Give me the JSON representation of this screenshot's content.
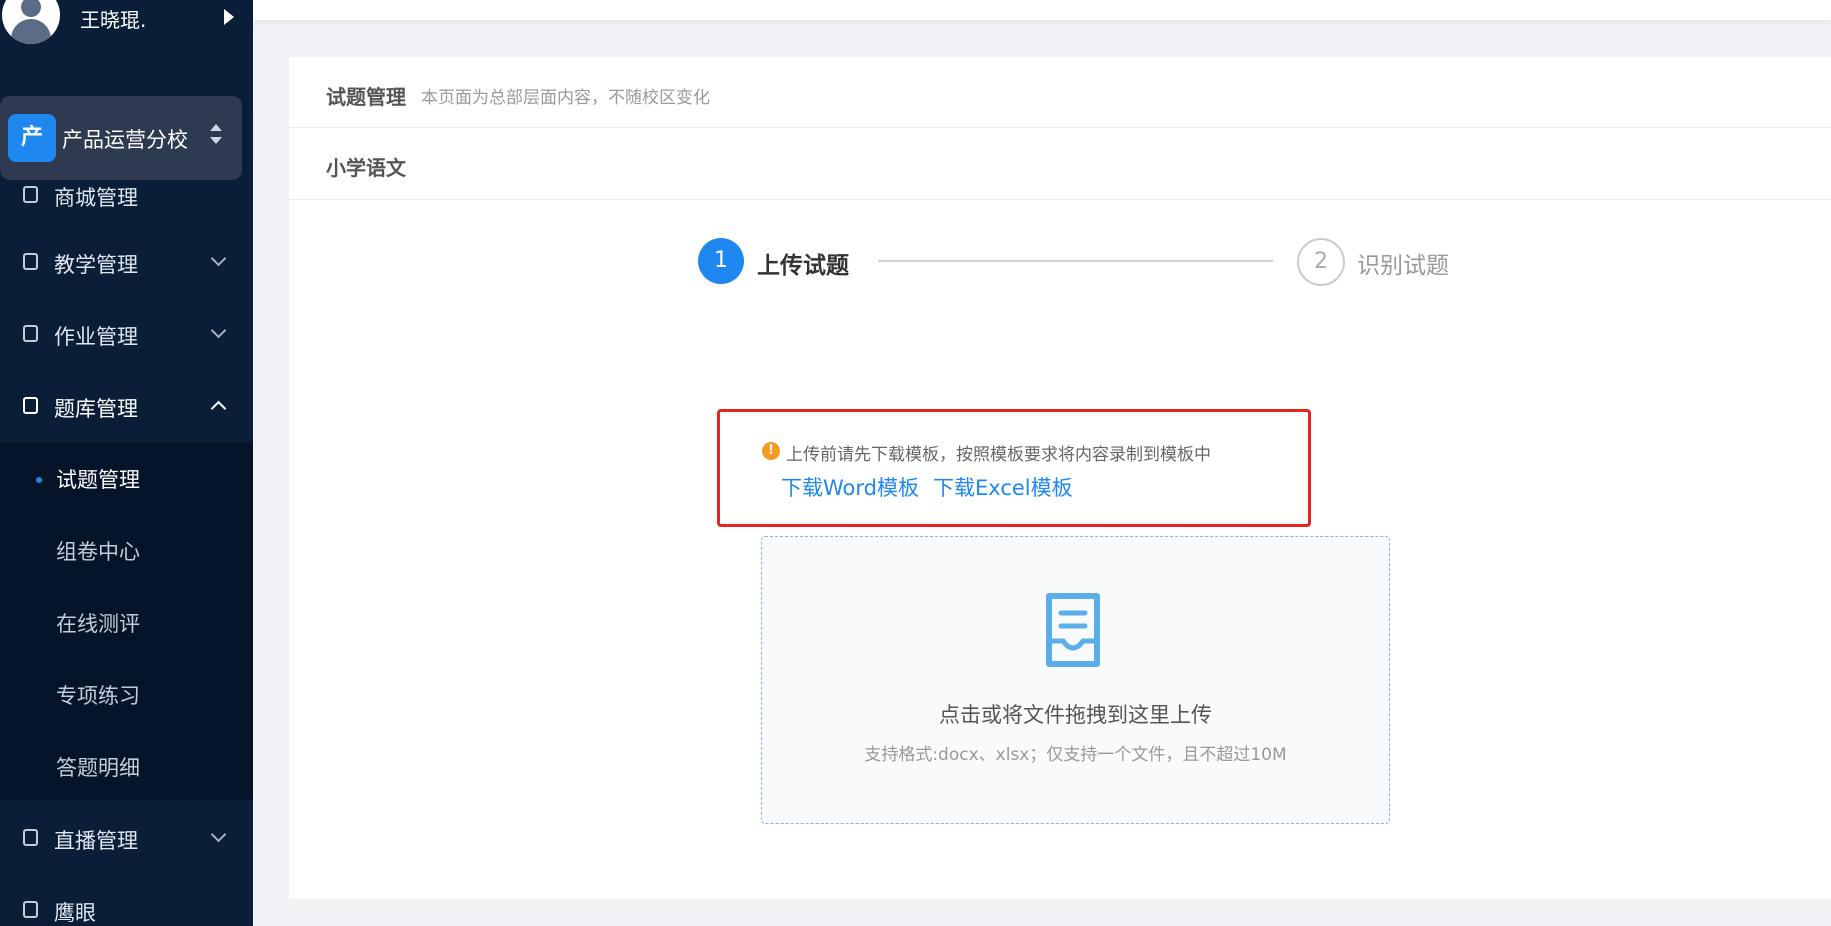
{
  "sidebar": {
    "user": {
      "name": "王晓琨."
    },
    "campus": {
      "badge": "产",
      "name": "产品运营分校"
    },
    "partial_item": {
      "label": "商城管理"
    },
    "menu": [
      {
        "label": "教学管理",
        "icon": "teaching-icon"
      },
      {
        "label": "作业管理",
        "icon": "homework-icon"
      },
      {
        "label": "题库管理",
        "icon": "question-bank-icon"
      },
      {
        "label": "直播管理",
        "icon": "live-icon"
      },
      {
        "label": "鹰眼",
        "icon": "eagle-eye-icon"
      }
    ],
    "submenu": [
      {
        "label": "试题管理"
      },
      {
        "label": "组卷中心"
      },
      {
        "label": "在线测评"
      },
      {
        "label": "专项练习"
      },
      {
        "label": "答题明细"
      }
    ]
  },
  "page": {
    "title": "试题管理",
    "description": "本页面为总部层面内容，不随校区变化",
    "subject": "小学语文"
  },
  "steps": [
    {
      "number": "1",
      "label": "上传试题",
      "state": "active"
    },
    {
      "number": "2",
      "label": "识别试题",
      "state": "pending"
    }
  ],
  "notice": {
    "text": "上传前请先下载模板，按照模板要求将内容录制到模板中",
    "link_word": "下载Word模板",
    "link_excel": "下载Excel模板"
  },
  "upload": {
    "main_text": "点击或将文件拖拽到这里上传",
    "hint": "支持格式:docx、xlsx；仅支持一个文件，且不超过10M"
  },
  "colors": {
    "sidebar_bg": "#0b1e38",
    "accent": "#1e88f0",
    "highlight_border": "#e5231f",
    "warning": "#f59a23"
  }
}
